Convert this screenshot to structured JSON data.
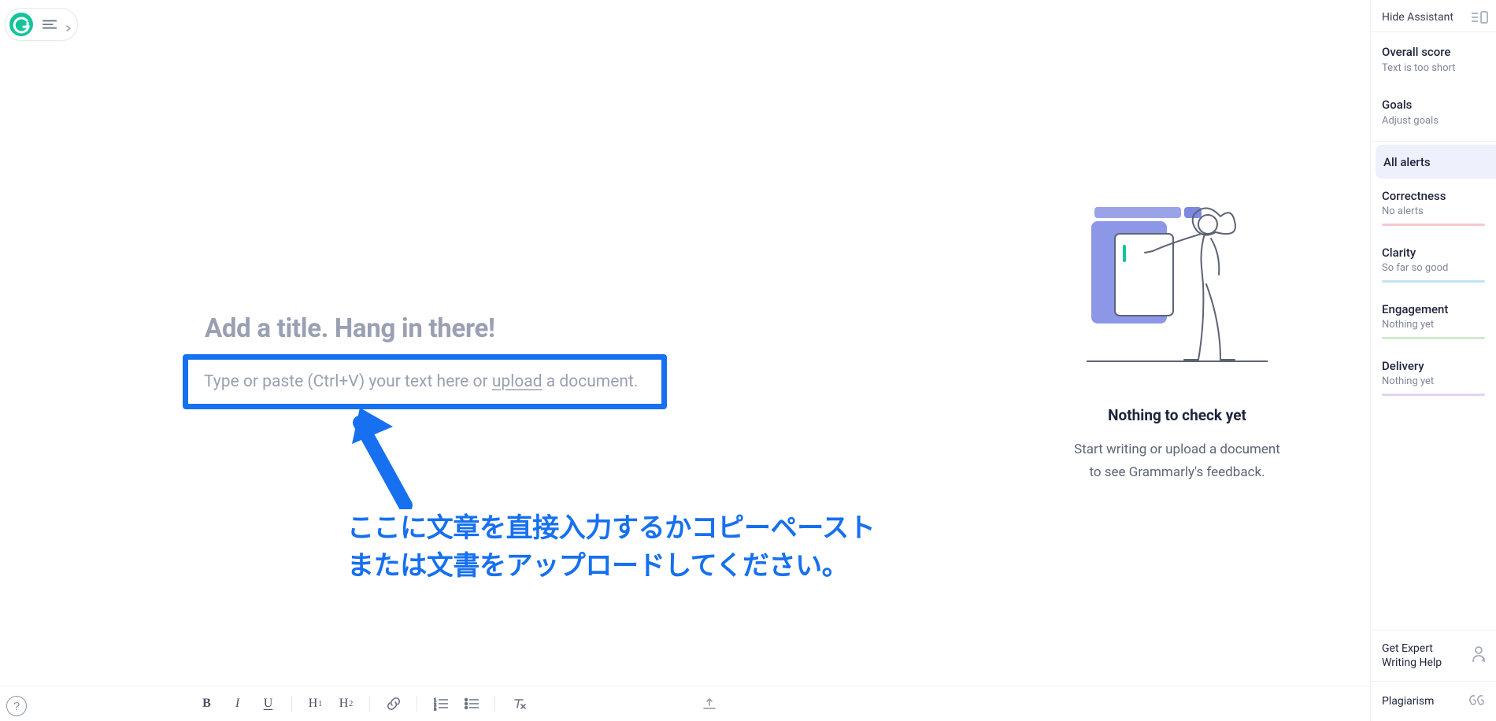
{
  "toolbar": {
    "app_name": "Grammarly"
  },
  "editor": {
    "title_placeholder": "Add a title. Hang in there!",
    "body_placeholder_pre": "Type or paste (Ctrl+V) your text here or ",
    "upload_word": "upload",
    "body_placeholder_post": " a document."
  },
  "annotation": {
    "line1": "ここに文章を直接入力するかコピーペースト",
    "line2": "または文書をアップロードしてください。"
  },
  "empty_state": {
    "title": "Nothing to check yet",
    "line1": "Start writing or upload a document",
    "line2": "to see Grammarly's feedback."
  },
  "assistant": {
    "hide_label": "Hide Assistant",
    "score": {
      "label": "Overall score",
      "sub": "Text is too short"
    },
    "goals": {
      "label": "Goals",
      "sub": "Adjust goals"
    },
    "all_alerts_label": "All alerts",
    "categories": {
      "correctness": {
        "label": "Correctness",
        "sub": "No alerts"
      },
      "clarity": {
        "label": "Clarity",
        "sub": "So far so good"
      },
      "engagement": {
        "label": "Engagement",
        "sub": "Nothing yet"
      },
      "delivery": {
        "label": "Delivery",
        "sub": "Nothing yet"
      }
    },
    "expert_label": "Get Expert Writing Help",
    "plagiarism_label": "Plagiarism"
  },
  "format": {
    "bold": "B",
    "italic": "I",
    "underline": "U",
    "h1": "H",
    "h1_sub": "1",
    "h2": "H",
    "h2_sub": "2"
  },
  "help_glyph": "?"
}
